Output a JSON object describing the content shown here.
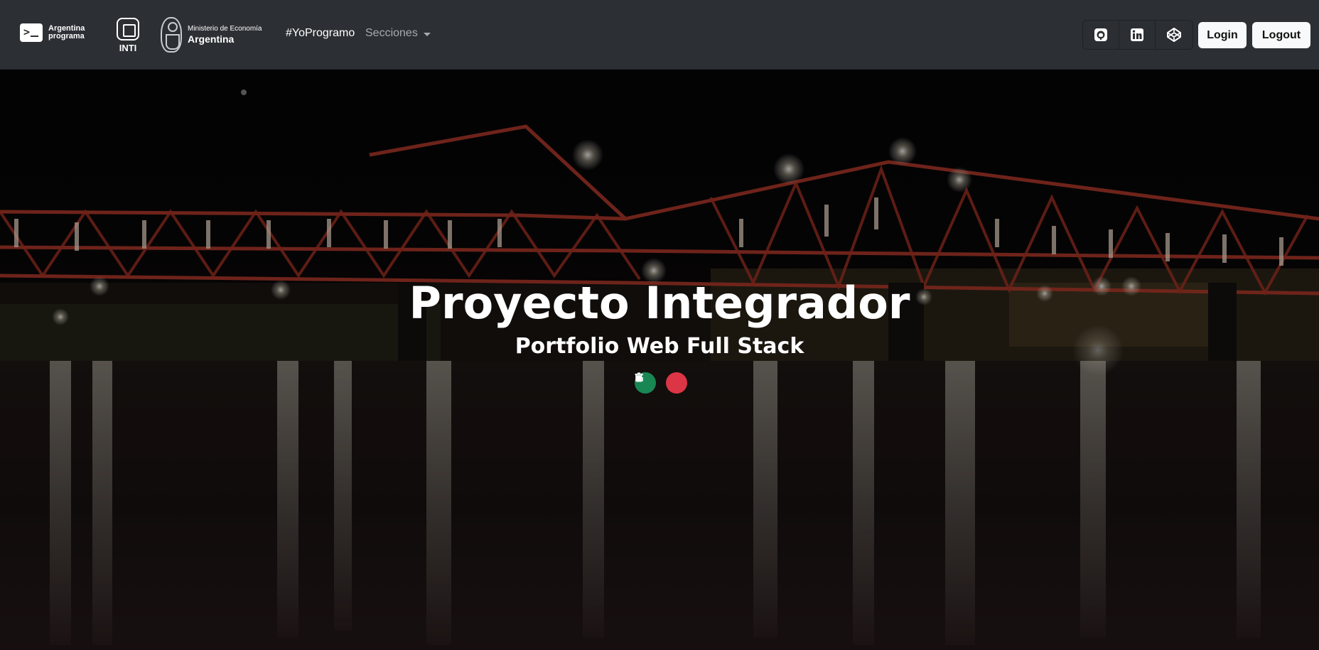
{
  "navbar": {
    "brand_ap": {
      "line1": "Argentina",
      "line2": "programa",
      "icon": "terminal-icon"
    },
    "brand_inti": {
      "text": "INTI",
      "icon": "inti-logo-icon"
    },
    "brand_ministerio": {
      "line1": "Ministerio de Economía",
      "line2": "Argentina",
      "icon": "escudo-icon"
    },
    "links": {
      "yoprogramo": "#YoProgramo",
      "secciones": "Secciones"
    },
    "social": [
      "github-icon",
      "linkedin-icon",
      "codepen-icon"
    ],
    "login_label": "Login",
    "logout_label": "Logout"
  },
  "hero": {
    "title": "Proyecto Integrador",
    "subtitle": "Portfolio Web Full Stack",
    "actions": [
      "edit-icon",
      "trash-icon"
    ]
  },
  "colors": {
    "navbar_bg": "#2c3034",
    "edit_green": "#198754",
    "delete_red": "#dc3545"
  }
}
